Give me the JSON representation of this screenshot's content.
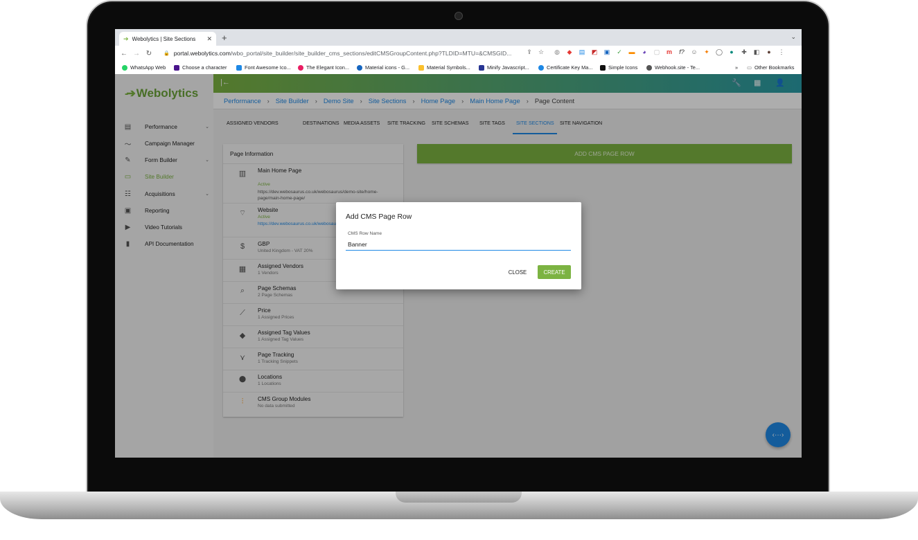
{
  "browser": {
    "tab_title": "Webolytics | Site Sections",
    "url_domain": "portal.webolytics.com",
    "url_path": "/wbo_portal/site_builder/site_builder_cms_sections/editCMSGroupContent.php?TLDID=MTU=&CMSGID...",
    "bookmarks": [
      {
        "label": "WhatsApp Web",
        "color": "#25d366"
      },
      {
        "label": "Choose a character",
        "color": "#4a148c"
      },
      {
        "label": "Font Awesome Ico...",
        "color": "#1e88e5"
      },
      {
        "label": "The Elegant Icon...",
        "color": "#e91e63"
      },
      {
        "label": "Material icons - G...",
        "color": "#1565c0"
      },
      {
        "label": "Material Symbols...",
        "color": "#fbc02d"
      },
      {
        "label": "Minify Javascript...",
        "color": "#283593"
      },
      {
        "label": "Certificate Key Ma...",
        "color": "#1e88e5"
      },
      {
        "label": "Simple Icons",
        "color": "#111111"
      },
      {
        "label": "Webhook.site - Te...",
        "color": "#555555"
      }
    ],
    "bookmarks_more": "»",
    "other_bookmarks": "Other Bookmarks"
  },
  "app": {
    "logo_text": "Webolytics",
    "brand_color": "#7cb342",
    "sidebar": [
      {
        "label": "Performance",
        "icon": "dashboard-icon",
        "glyph": "▤",
        "chevron": true
      },
      {
        "label": "Campaign Manager",
        "icon": "trend-icon",
        "glyph": "〜",
        "chevron": false
      },
      {
        "label": "Form Builder",
        "icon": "edit-icon",
        "glyph": "✎",
        "chevron": true
      },
      {
        "label": "Site Builder",
        "icon": "web-icon",
        "glyph": "▭",
        "chevron": false,
        "active": true
      },
      {
        "label": "Acquisitions",
        "icon": "people-icon",
        "glyph": "👥",
        "chevron": true
      },
      {
        "label": "Reporting",
        "icon": "report-icon",
        "glyph": "▣",
        "chevron": false
      },
      {
        "label": "Video Tutorials",
        "icon": "video-icon",
        "glyph": "▶",
        "chevron": false
      },
      {
        "label": "API Documentation",
        "icon": "book-icon",
        "glyph": "▮",
        "chevron": false
      }
    ],
    "breadcrumb": [
      "Performance",
      "Site Builder",
      "Demo Site",
      "Site Sections",
      "Home Page",
      "Main Home Page"
    ],
    "breadcrumb_current": "Page Content",
    "page_tabs": [
      "ASSIGNED VENDORS",
      "DESTINATIONS",
      "MEDIA ASSETS",
      "SITE TRACKING",
      "SITE SCHEMAS",
      "SITE TAGS",
      "SITE SECTIONS",
      "SITE NAVIGATION"
    ],
    "active_tab": "SITE SECTIONS",
    "info_card": {
      "title": "Page Information",
      "main": {
        "title": "Main Home Page",
        "status": "Active",
        "url": "https://dev.webosaurus.co.uk/webosaurus/demo-site/home-page/main-home-page/"
      },
      "website": {
        "title": "Website",
        "status": "Active",
        "url": "https://dev.webosaurus.co.uk/webosaurus/demo-site/"
      },
      "rows": [
        {
          "title": "GBP",
          "sub": "United Kingdom - VAT 20%",
          "icon": "currency-icon",
          "glyph": "$"
        },
        {
          "title": "Assigned Vendors",
          "sub": "1 Vendors",
          "icon": "business-icon",
          "glyph": "▦"
        },
        {
          "title": "Page Schemas",
          "sub": "2 Page Schemas",
          "icon": "schema-search-icon",
          "glyph": "⌕"
        },
        {
          "title": "Price",
          "sub": "1 Assigned Prices",
          "icon": "chart-line-icon",
          "glyph": "⟋"
        },
        {
          "title": "Assigned Tag Values",
          "sub": "1 Assigned Tag Values",
          "icon": "tag-icon",
          "glyph": "◆"
        },
        {
          "title": "Page Tracking",
          "sub": "1 Tracking Snippets",
          "icon": "tracking-icon",
          "glyph": "⋎"
        },
        {
          "title": "Locations",
          "sub": "1 Locations",
          "icon": "location-icon",
          "glyph": "⬤"
        },
        {
          "title": "CMS Group Modules",
          "sub": "No data submitted",
          "icon": "modules-icon",
          "glyph": "⫶"
        }
      ]
    },
    "add_button": "ADD CMS PAGE ROW",
    "dialog": {
      "title": "Add CMS Page Row",
      "field_label": "CMS Row Name",
      "field_value": "Banner",
      "close_label": "CLOSE",
      "create_label": "CREATE"
    },
    "fab_label": "‹···›"
  }
}
